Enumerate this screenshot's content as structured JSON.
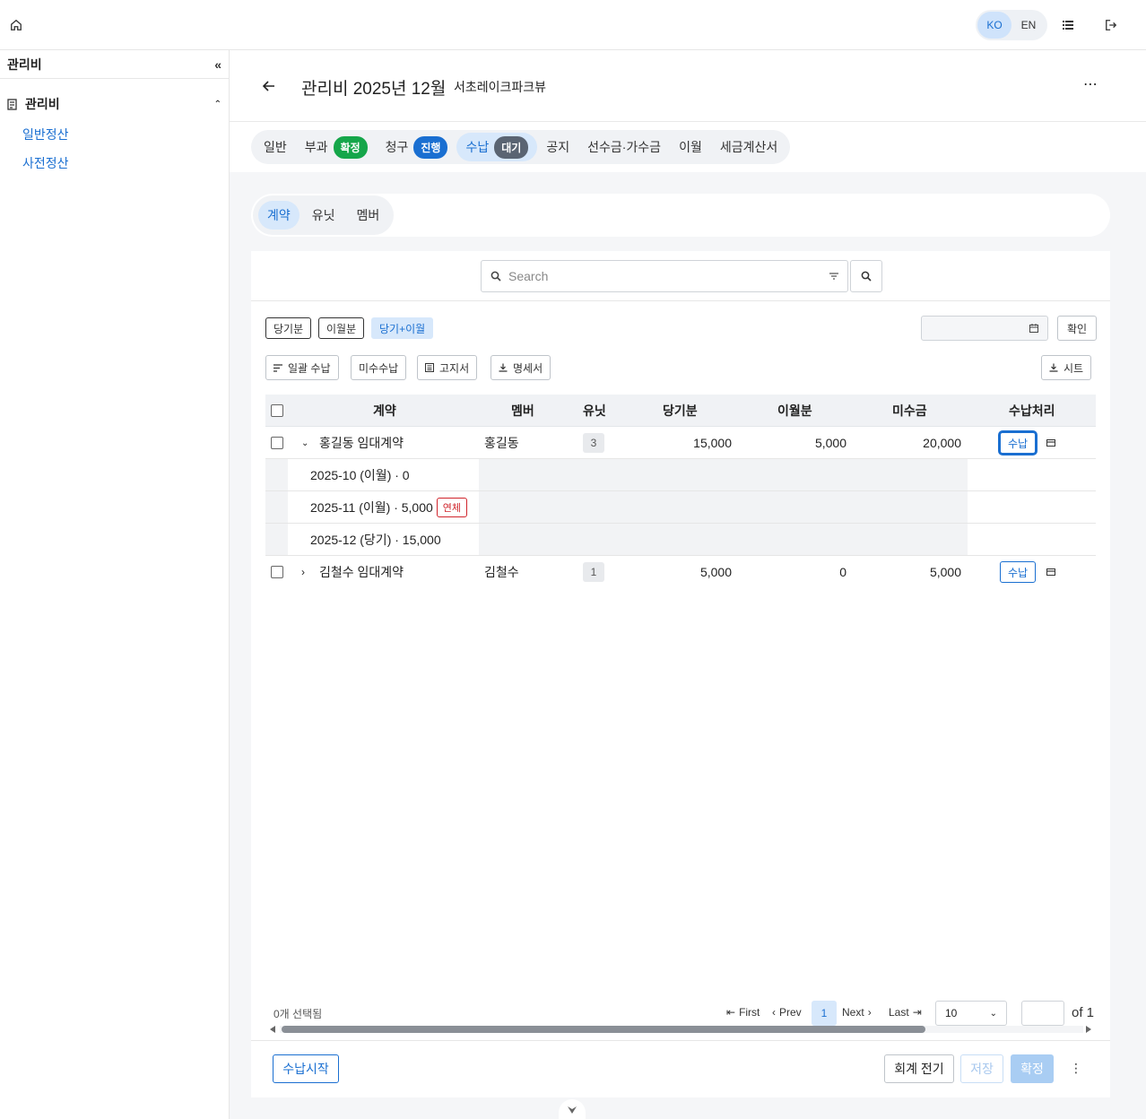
{
  "topbar": {
    "lang": [
      "KO",
      "EN"
    ],
    "icons": [
      "home-icon",
      "list-icon",
      "logout-icon"
    ]
  },
  "sidebar": {
    "header": "관리비",
    "group": "관리비",
    "items": [
      "일반정산",
      "사전정산"
    ]
  },
  "page": {
    "title": "관리비 2025년 12월",
    "subtitle": "서초레이크파크뷰"
  },
  "tabs": [
    {
      "label": "일반"
    },
    {
      "label": "부과",
      "badge": "확정",
      "badge_color": "#15a64a"
    },
    {
      "label": "청구",
      "badge": "진행",
      "badge_color": "#1a6fd1"
    },
    {
      "label": "수납",
      "badge": "대기",
      "badge_color": "#5a6472",
      "active": true
    },
    {
      "label": "공지"
    },
    {
      "label": "선수금·가수금"
    },
    {
      "label": "이월"
    },
    {
      "label": "세금계산서"
    }
  ],
  "subtabs": [
    "계약",
    "유닛",
    "멤버"
  ],
  "search": {
    "placeholder": "Search"
  },
  "filters": {
    "period_buttons": [
      "당기분",
      "이월분",
      "당기+이월"
    ],
    "confirm": "확인"
  },
  "actions": {
    "bulk_pay": "일괄 수납",
    "unpaid": "미수수납",
    "notice": "고지서",
    "statement": "명세서",
    "sheet": "시트"
  },
  "table": {
    "headers": [
      "계약",
      "멤버",
      "유닛",
      "당기분",
      "이월분",
      "미수금",
      "수납처리"
    ],
    "rows": [
      {
        "contract": "홍길동 임대계약",
        "member": "홍길동",
        "unit": "3",
        "current": "15,000",
        "carried": "5,000",
        "unpaid": "20,000",
        "pay": "수납",
        "details": [
          {
            "text": "2025-10 (이월) · 0"
          },
          {
            "text": "2025-11 (이월) · 5,000",
            "badge": "연체"
          },
          {
            "text": "2025-12 (당기) · 15,000"
          }
        ]
      },
      {
        "contract": "김철수 임대계약",
        "member": "김철수",
        "unit": "1",
        "current": "5,000",
        "carried": "0",
        "unpaid": "5,000",
        "pay": "수납"
      }
    ]
  },
  "pager": {
    "selected": "0개 선택됨",
    "first": "First",
    "prev": "Prev",
    "page": "1",
    "next": "Next",
    "last": "Last",
    "page_size": "10",
    "of": "of 1"
  },
  "footer": {
    "start": "수납시작",
    "post": "회계 전기",
    "save": "저장",
    "finalize": "확정"
  }
}
